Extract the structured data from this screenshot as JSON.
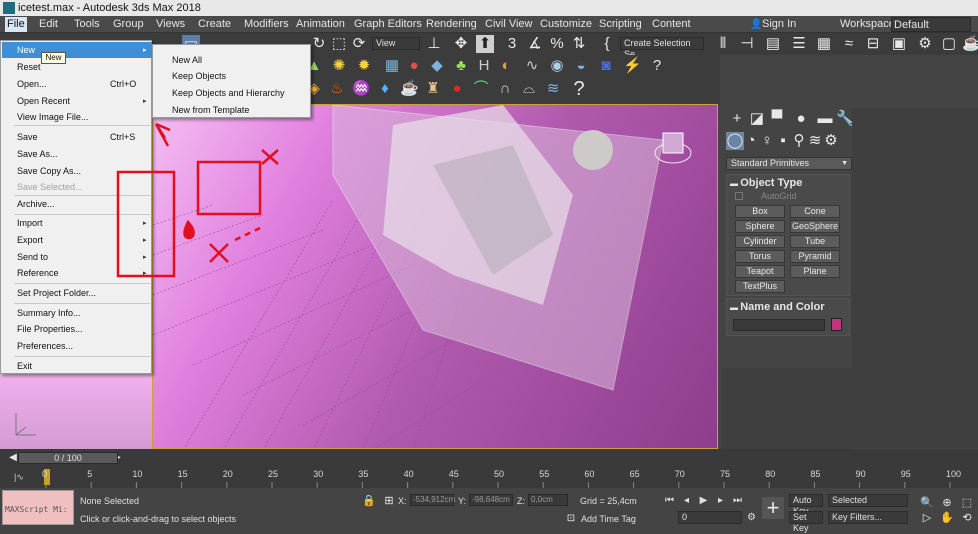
{
  "window": {
    "title": "icetest.max - Autodesk 3ds Max 2018"
  },
  "menubar": {
    "items": [
      "File",
      "Edit",
      "Tools",
      "Group",
      "Views",
      "Create",
      "Modifiers",
      "Animation",
      "Graph Editors",
      "Rendering",
      "Civil View",
      "Customize",
      "Scripting",
      "Content"
    ],
    "signin": "Sign In",
    "workspaces_label": "Workspaces:",
    "workspaces_value": "Default"
  },
  "toolbar": {
    "view_dropdown": "View",
    "selection_set": "Create Selection Se"
  },
  "file_menu": {
    "items": [
      {
        "label": "New",
        "shortcut": "",
        "arrow": "▸",
        "highlighted": true
      },
      {
        "label": "Reset",
        "shortcut": ""
      },
      {
        "label": "Open...",
        "shortcut": "Ctrl+O"
      },
      {
        "label": "Open Recent",
        "shortcut": "",
        "arrow": "▸"
      },
      {
        "label": "View Image File...",
        "shortcut": ""
      },
      {
        "label": "Save",
        "shortcut": "Ctrl+S"
      },
      {
        "label": "Save As...",
        "shortcut": ""
      },
      {
        "label": "Save Copy As...",
        "shortcut": ""
      },
      {
        "label": "Save Selected...",
        "shortcut": "",
        "disabled": true
      },
      {
        "label": "Archive...",
        "shortcut": ""
      },
      {
        "label": "Import",
        "shortcut": "",
        "arrow": "▸"
      },
      {
        "label": "Export",
        "shortcut": "",
        "arrow": "▸"
      },
      {
        "label": "Send to",
        "shortcut": "",
        "arrow": "▸"
      },
      {
        "label": "Reference",
        "shortcut": "",
        "arrow": "▸"
      },
      {
        "label": "Set Project Folder...",
        "shortcut": ""
      },
      {
        "label": "Summary Info...",
        "shortcut": ""
      },
      {
        "label": "File Properties...",
        "shortcut": ""
      },
      {
        "label": "Preferences...",
        "shortcut": ""
      },
      {
        "label": "Exit",
        "shortcut": ""
      }
    ],
    "tooltip": "New"
  },
  "new_submenu": {
    "items": [
      "New All",
      "Keep Objects",
      "Keep Objects and Hierarchy",
      "New from Template"
    ]
  },
  "command_panel": {
    "dropdown": "Standard Primitives",
    "object_type_header": "Object Type",
    "autogrid": "AutoGrid",
    "buttons": [
      "Box",
      "Cone",
      "Sphere",
      "GeoSphere",
      "Cylinder",
      "Tube",
      "Torus",
      "Pyramid",
      "Teapot",
      "Plane",
      "TextPlus"
    ],
    "name_color_header": "Name and Color",
    "color_swatch": "#c3347f"
  },
  "timeline": {
    "frame_display": "0 / 100",
    "ticks": [
      "0",
      "5",
      "10",
      "15",
      "20",
      "25",
      "30",
      "35",
      "40",
      "45",
      "50",
      "55",
      "60",
      "65",
      "70",
      "75",
      "80",
      "85",
      "90",
      "95",
      "100"
    ]
  },
  "status": {
    "maxscript": "MAXScript Mi:",
    "selection": "None Selected",
    "prompt": "Click or click-and-drag to select objects",
    "x_label": "X:",
    "x_value": "-534,912cm",
    "y_label": "Y:",
    "y_value": "-98,648cm",
    "z_label": "Z:",
    "z_value": "0,0cm",
    "grid": "Grid = 25,4cm",
    "add_time_tag": "Add Time Tag",
    "auto_key": "Auto Key",
    "selected": "Selected",
    "set_key": "Set Key",
    "key_filters": "Key Filters...",
    "frame": "0"
  },
  "colors": {
    "viewport_bg": "#c063be",
    "accent_highlight": "#3e8fd6",
    "annotation_red": "#e0101e"
  }
}
